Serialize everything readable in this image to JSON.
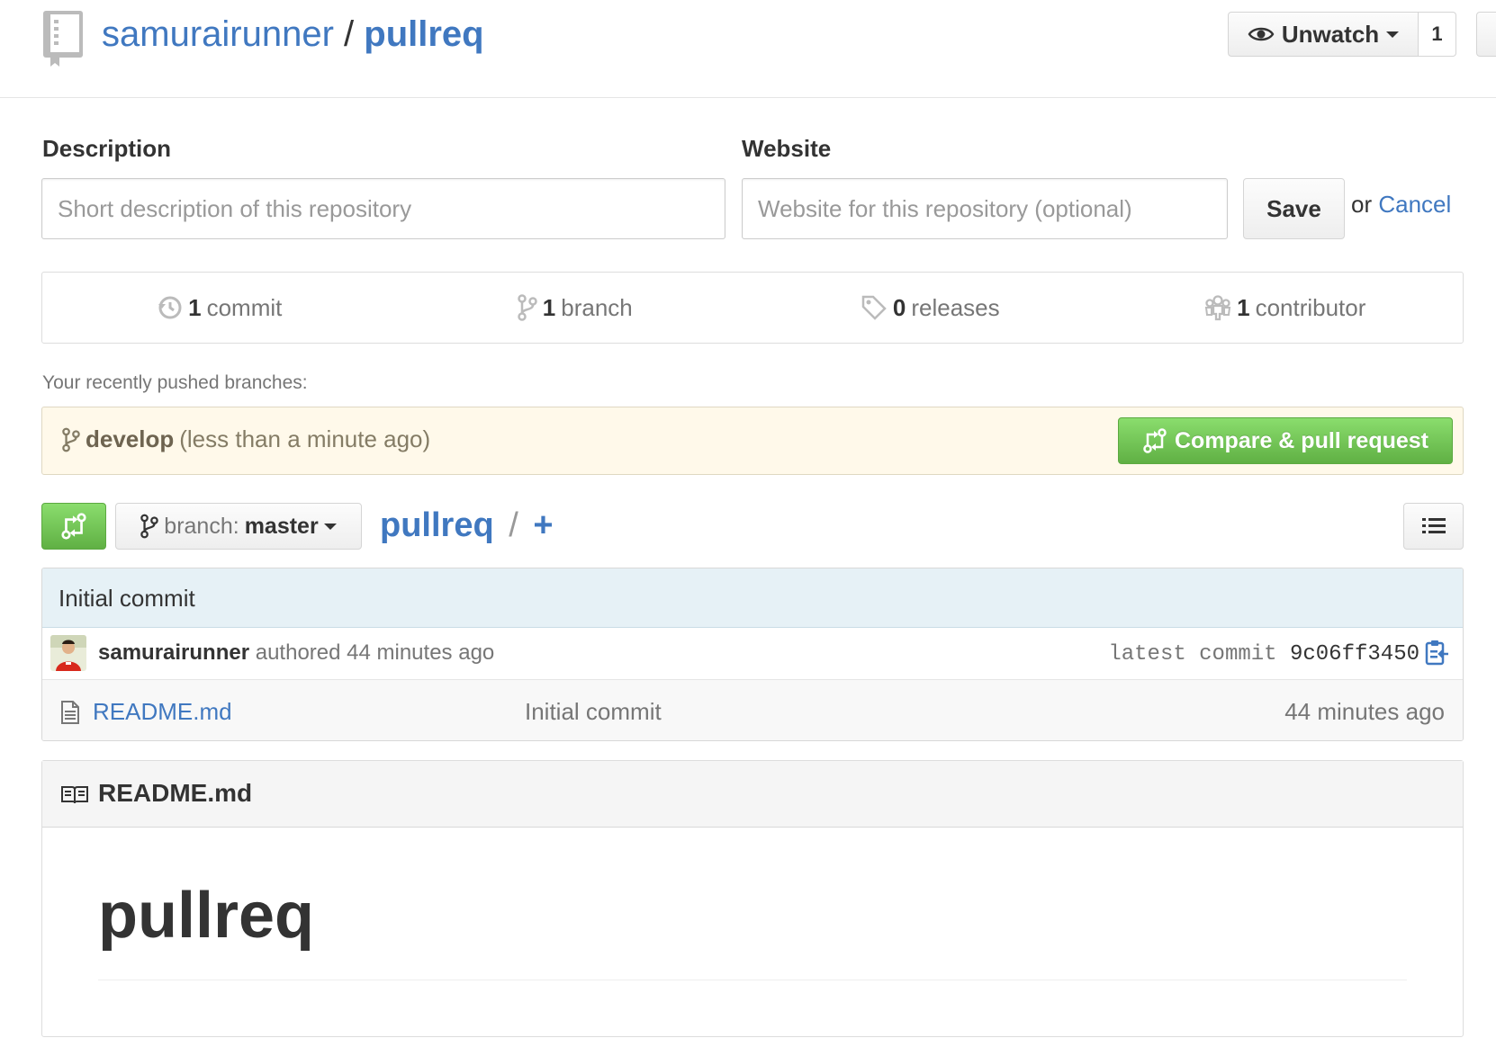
{
  "header": {
    "owner": "samurairunner",
    "separator": "/",
    "repo": "pullreq",
    "watch_label": "Unwatch",
    "watch_count": "1"
  },
  "edit_form": {
    "description_label": "Description",
    "description_placeholder": "Short description of this repository",
    "website_label": "Website",
    "website_placeholder": "Website for this repository (optional)",
    "save_label": "Save",
    "or_text": "or",
    "cancel_label": "Cancel"
  },
  "summary": {
    "commits_count": "1",
    "commits_label": "commit",
    "branches_count": "1",
    "branches_label": "branch",
    "releases_count": "0",
    "releases_label": "releases",
    "contributors_count": "1",
    "contributors_label": "contributor"
  },
  "recent_branches": {
    "label": "Your recently pushed branches:",
    "branch_name": "develop",
    "branch_time": "(less than a minute ago)",
    "compare_label": "Compare & pull request"
  },
  "file_nav": {
    "branch_prefix": "branch:",
    "branch_name": "master",
    "breadcrumb_root": "pullreq",
    "breadcrumb_sep": "/",
    "breadcrumb_plus": "+"
  },
  "commit_tease": {
    "message": "Initial commit",
    "author": "samurairunner",
    "authored_text": "authored 44 minutes ago",
    "latest_label": "latest commit",
    "sha": "9c06ff3450"
  },
  "files": [
    {
      "name": "README.md",
      "message": "Initial commit",
      "age": "44 minutes ago"
    }
  ],
  "readme": {
    "title": "README.md",
    "heading": "pullreq"
  },
  "colors": {
    "link": "#4078c0",
    "green_button": "#60b044",
    "commit_bar": "#e6f1f6",
    "recent_box": "#fff9ea"
  }
}
